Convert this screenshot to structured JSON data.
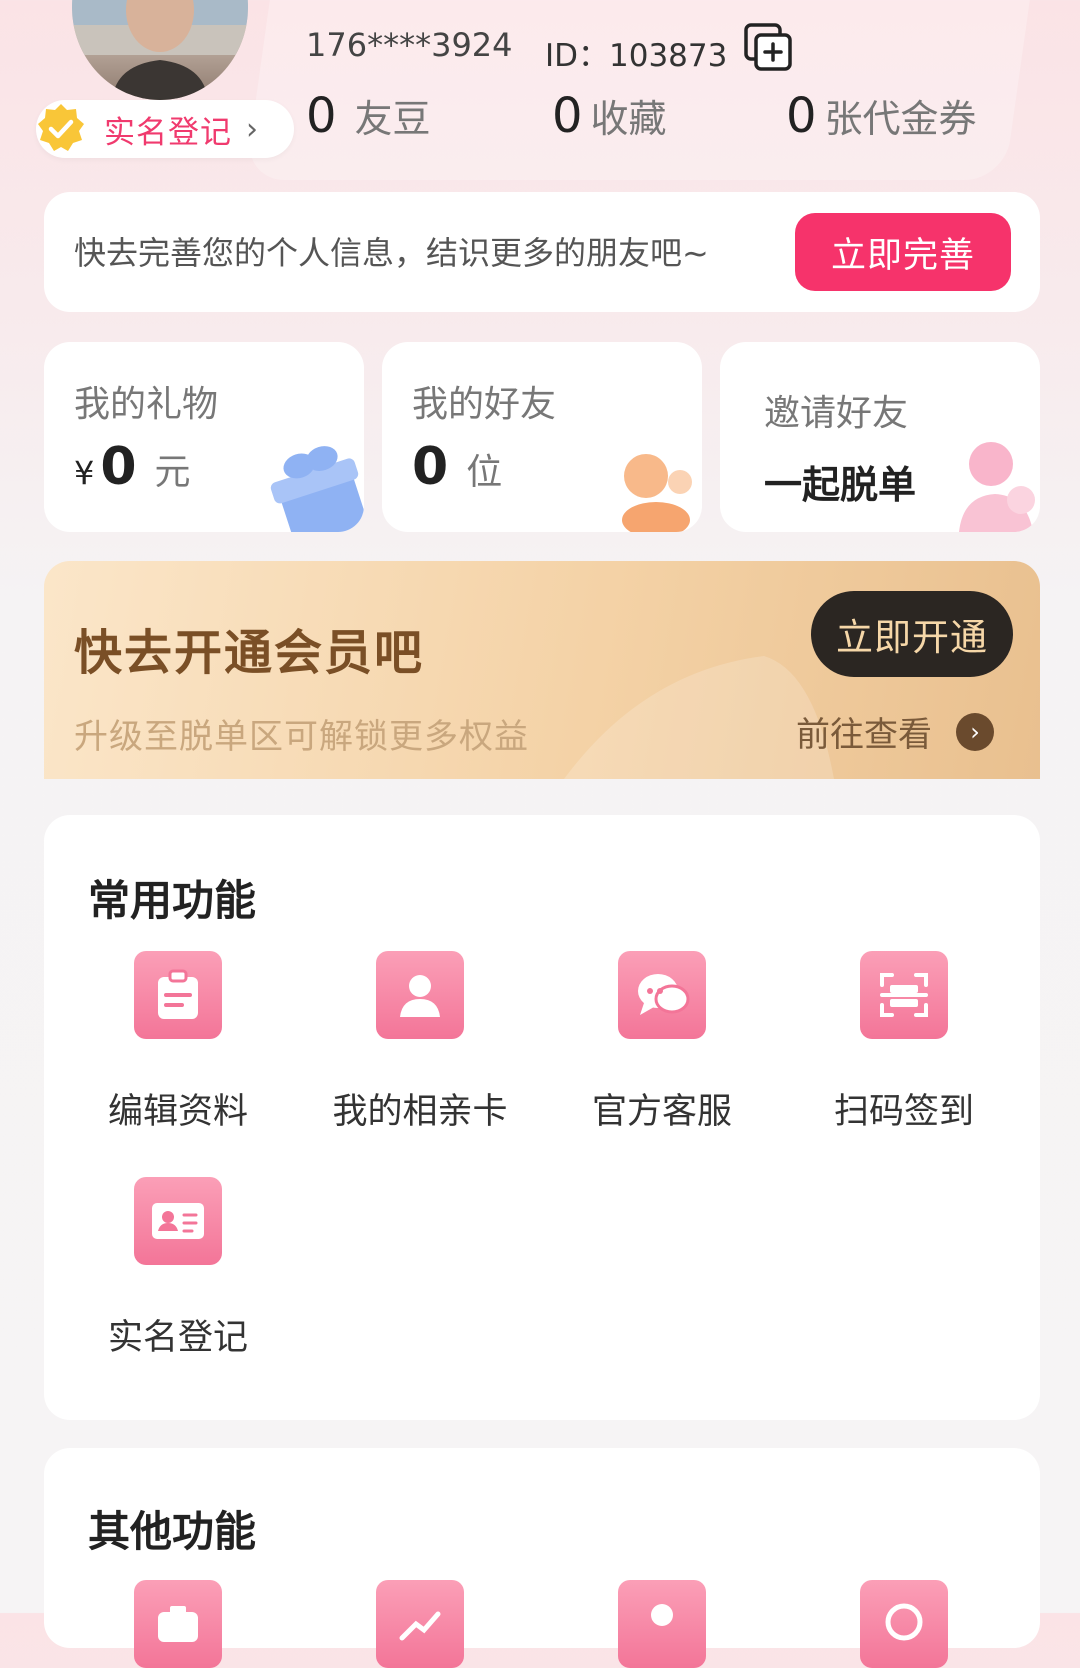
{
  "header": {
    "phone": "176****3924",
    "user_id": "ID：103873",
    "verify_label": "实名登记",
    "stats": [
      {
        "value": "0",
        "label": "友豆"
      },
      {
        "value": "0",
        "label": "收藏"
      },
      {
        "value": "0",
        "label": "张代金券"
      }
    ]
  },
  "profile_prompt": {
    "text": "快去完善您的个人信息，结识更多的朋友吧~",
    "button": "立即完善"
  },
  "cards": {
    "gifts": {
      "title": "我的礼物",
      "currency": "¥",
      "value": "0",
      "unit": "元"
    },
    "friends": {
      "title": "我的好友",
      "value": "0",
      "unit": "位"
    },
    "invite": {
      "title": "邀请好友",
      "subtitle": "一起脱单"
    }
  },
  "vip": {
    "title": "快去开通会员吧",
    "subtitle": "升级至脱单区可解锁更多权益",
    "button": "立即开通",
    "link": "前往查看"
  },
  "common_functions": {
    "title": "常用功能",
    "items": [
      {
        "label": "编辑资料",
        "icon": "clipboard-icon"
      },
      {
        "label": "我的相亲卡",
        "icon": "person-icon"
      },
      {
        "label": "官方客服",
        "icon": "chat-bubbles-icon"
      },
      {
        "label": "扫码签到",
        "icon": "scan-icon"
      },
      {
        "label": "实名登记",
        "icon": "id-card-icon"
      }
    ]
  },
  "other_functions": {
    "title": "其他功能"
  },
  "colors": {
    "accent": "#f6336b",
    "icon_pink": "#f37598",
    "vip_gold": "#f4d2a6"
  }
}
